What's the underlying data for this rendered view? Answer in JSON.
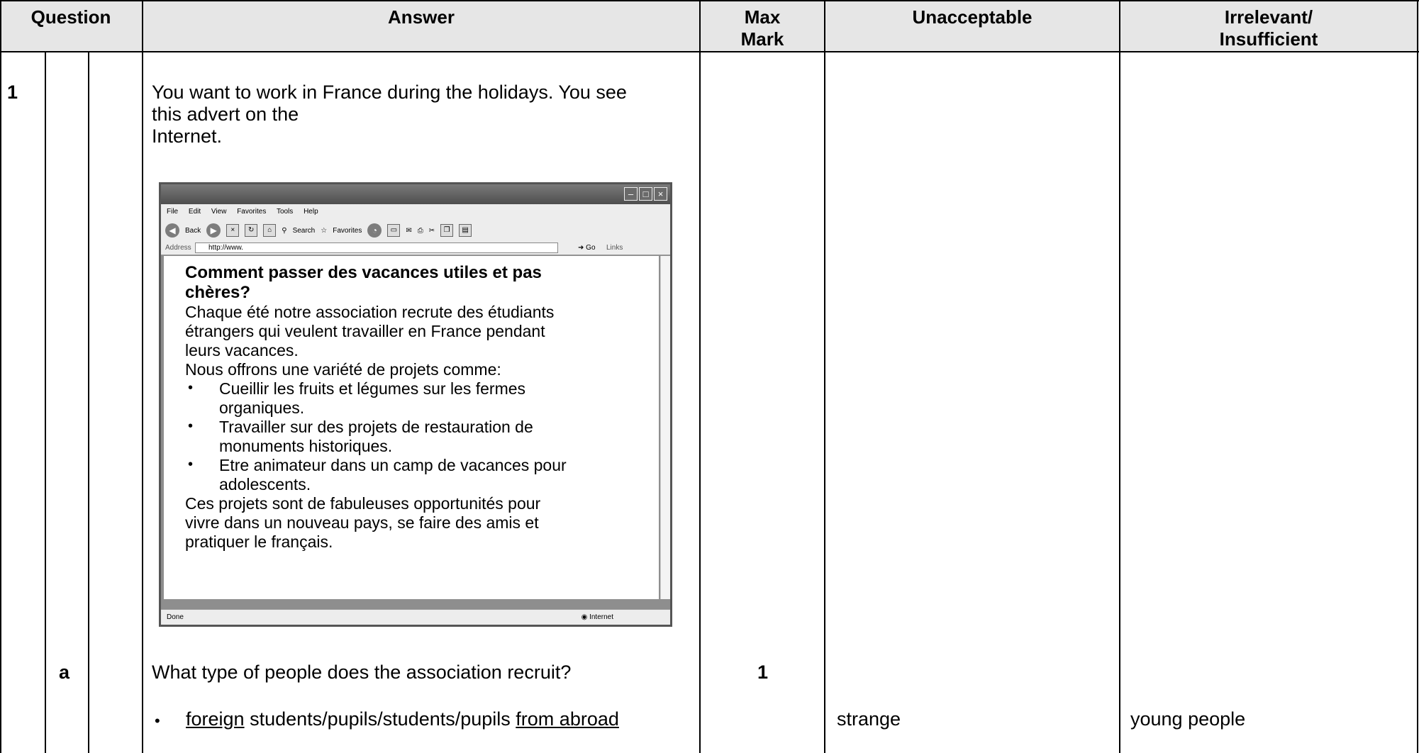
{
  "header": {
    "question": "Question",
    "answer": "Answer",
    "max_mark": "Max Mark",
    "unacceptable": "Unacceptable",
    "irrelevant": "Irrelevant/ Insufficient"
  },
  "row1": {
    "number": "1",
    "intro_line1": "You want to work in France during the holidays.  You see",
    "intro_line2": "this advert on the",
    "intro_line3": "Internet."
  },
  "browser": {
    "menu": [
      "File",
      "Edit",
      "View",
      "Favorites",
      "Tools",
      "Help"
    ],
    "back": "Back",
    "search": "Search",
    "favorites": "Favorites",
    "address_label": "Address",
    "address_value": "http://www.",
    "go": "Go",
    "links": "Links",
    "status_left": "Done",
    "status_right": "Internet",
    "advert": {
      "title": "Comment passer des vacances utiles et pas chères?",
      "p1_l1": "Chaque été notre association recrute des étudiants",
      "p1_l2": "étrangers qui veulent travailler en France pendant",
      "p1_l3": "leurs vacances.",
      "p2": "Nous offrons une variété de projets comme:",
      "b1_l1": "Cueillir les fruits et légumes sur les fermes",
      "b1_l2": "organiques.",
      "b2_l1": "Travailler sur des projets de restauration de",
      "b2_l2": "monuments historiques.",
      "b3_l1": "Etre animateur dans un camp de vacances pour",
      "b3_l2": "adolescents.",
      "p3_l1": "Ces projets sont de fabuleuses opportunités pour",
      "p3_l2": "vivre dans un nouveau pays, se faire des amis et",
      "p3_l3": "pratiquer le français."
    }
  },
  "row_a": {
    "letter": "a",
    "question": "What type of people does the association recruit?",
    "max_mark": "1",
    "answer_u1": "foreign",
    "answer_mid": " students/pupils/students/pupils ",
    "answer_u2": "from abroad",
    "unacceptable": "strange",
    "irrelevant": "young people"
  }
}
